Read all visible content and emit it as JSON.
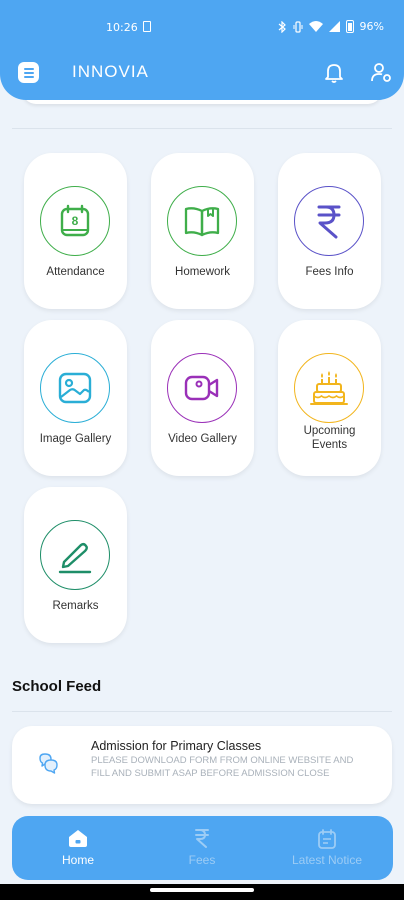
{
  "status_bar": {
    "time": "10:26",
    "battery": "96%"
  },
  "header": {
    "title": "INNOVIA"
  },
  "modules": [
    {
      "label": "Attendance",
      "icon": "calendar-icon",
      "color": "#3fae4a"
    },
    {
      "label": "Homework",
      "icon": "book-icon",
      "color": "#3fae4a"
    },
    {
      "label": "Fees Info",
      "icon": "rupee-icon",
      "color": "#5a52c8"
    },
    {
      "label": "Image Gallery",
      "icon": "image-icon",
      "color": "#2aaed6"
    },
    {
      "label": "Video Gallery",
      "icon": "video-icon",
      "color": "#9a30b8"
    },
    {
      "label": "Upcoming Events",
      "icon": "cake-icon",
      "color": "#f2b51d"
    },
    {
      "label": "Remarks",
      "icon": "pencil-icon",
      "color": "#1e8e68"
    }
  ],
  "feed": {
    "title": "School Feed",
    "items": [
      {
        "title": "Admission for Primary Classes",
        "description": "PLEASE DOWNLOAD FORM FROM ONLINE WEBSITE AND FILL AND SUBMIT ASAP BEFORE ADMISSION CLOSE"
      }
    ]
  },
  "bottom_nav": [
    {
      "label": "Home",
      "icon": "home-icon",
      "active": true
    },
    {
      "label": "Fees",
      "icon": "rupee-icon",
      "active": false
    },
    {
      "label": "Latest Notice",
      "icon": "notice-icon",
      "active": false
    }
  ],
  "colors": {
    "primary": "#4ea6f2",
    "background": "#edf3fa",
    "inactive_nav": "#9cccf5"
  }
}
